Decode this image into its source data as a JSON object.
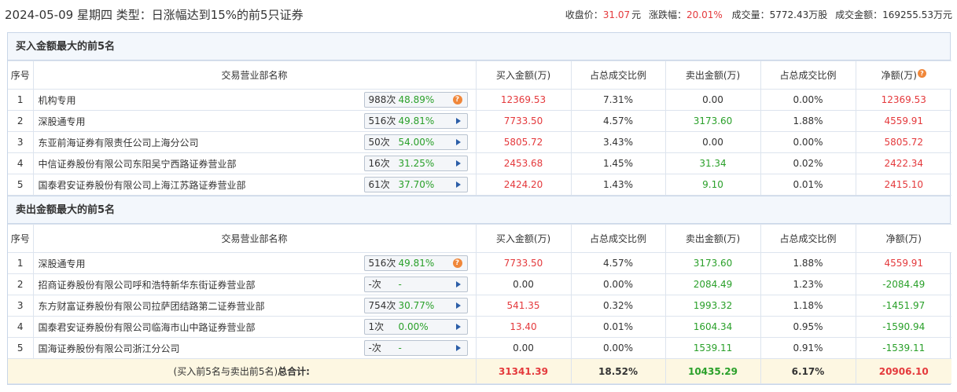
{
  "header": {
    "title": "2024-05-09 星期四 类型：日涨幅达到15%的前5只证券",
    "close_label": "收盘价：",
    "close_value": "31.07",
    "close_unit": "元",
    "change_label": "涨跌幅：",
    "change_value": "20.01%",
    "volume_label": "成交量：",
    "volume_value": "5772.43万股",
    "amount_label": "成交金额：",
    "amount_value": "169255.53万元"
  },
  "columns": [
    "序号",
    "交易营业部名称",
    "买入金额(万)",
    "占总成交比例",
    "卖出金额(万)",
    "占总成交比例",
    "净额(万)"
  ],
  "buy_section": {
    "title": "买入金额最大的前5名",
    "rows": [
      {
        "idx": "1",
        "name": "机构专用",
        "count": "988次",
        "pct": "48.89%",
        "icon": "question-icon",
        "buy": "12369.53",
        "buy_ratio": "7.31%",
        "sell": "0.00",
        "sell_ratio": "0.00%",
        "net": "12369.53",
        "sell_color": "dark",
        "net_color": "red"
      },
      {
        "idx": "2",
        "name": "深股通专用",
        "count": "516次",
        "pct": "49.81%",
        "icon": "arrow-right-icon",
        "buy": "7733.50",
        "buy_ratio": "4.57%",
        "sell": "3173.60",
        "sell_ratio": "1.88%",
        "net": "4559.91",
        "sell_color": "green",
        "net_color": "red"
      },
      {
        "idx": "3",
        "name": "东亚前海证券有限责任公司上海分公司",
        "count": "50次",
        "pct": "54.00%",
        "icon": "arrow-right-icon",
        "buy": "5805.72",
        "buy_ratio": "3.43%",
        "sell": "0.00",
        "sell_ratio": "0.00%",
        "net": "5805.72",
        "sell_color": "dark",
        "net_color": "red"
      },
      {
        "idx": "4",
        "name": "中信证券股份有限公司东阳吴宁西路证券营业部",
        "count": "16次",
        "pct": "31.25%",
        "icon": "arrow-right-icon",
        "buy": "2453.68",
        "buy_ratio": "1.45%",
        "sell": "31.34",
        "sell_ratio": "0.02%",
        "net": "2422.34",
        "sell_color": "green",
        "net_color": "red"
      },
      {
        "idx": "5",
        "name": "国泰君安证券股份有限公司上海江苏路证券营业部",
        "count": "61次",
        "pct": "37.70%",
        "icon": "arrow-right-icon",
        "buy": "2424.20",
        "buy_ratio": "1.43%",
        "sell": "9.10",
        "sell_ratio": "0.01%",
        "net": "2415.10",
        "sell_color": "green",
        "net_color": "red"
      }
    ]
  },
  "sell_section": {
    "title": "卖出金额最大的前5名",
    "rows": [
      {
        "idx": "1",
        "name": "深股通专用",
        "count": "516次",
        "pct": "49.81%",
        "icon": "question-icon",
        "buy": "7733.50",
        "buy_ratio": "4.57%",
        "sell": "3173.60",
        "sell_ratio": "1.88%",
        "net": "4559.91",
        "buy_color": "red",
        "net_color": "red"
      },
      {
        "idx": "2",
        "name": "招商证券股份有限公司呼和浩特新华东街证券营业部",
        "count": "-次",
        "pct": "-",
        "icon": "arrow-right-icon",
        "buy": "0.00",
        "buy_ratio": "0.00%",
        "sell": "2084.49",
        "sell_ratio": "1.23%",
        "net": "-2084.49",
        "buy_color": "dark",
        "net_color": "green"
      },
      {
        "idx": "3",
        "name": "东方财富证券股份有限公司拉萨团结路第二证券营业部",
        "count": "754次",
        "pct": "30.77%",
        "icon": "arrow-right-icon",
        "buy": "541.35",
        "buy_ratio": "0.32%",
        "sell": "1993.32",
        "sell_ratio": "1.18%",
        "net": "-1451.97",
        "buy_color": "red",
        "net_color": "green"
      },
      {
        "idx": "4",
        "name": "国泰君安证券股份有限公司临海市山中路证券营业部",
        "count": "1次",
        "pct": "0.00%",
        "icon": "arrow-right-icon",
        "buy": "13.40",
        "buy_ratio": "0.01%",
        "sell": "1604.34",
        "sell_ratio": "0.95%",
        "net": "-1590.94",
        "buy_color": "red",
        "net_color": "green"
      },
      {
        "idx": "5",
        "name": "国海证券股份有限公司浙江分公司",
        "count": "-次",
        "pct": "-",
        "icon": "arrow-right-icon",
        "buy": "0.00",
        "buy_ratio": "0.00%",
        "sell": "1539.11",
        "sell_ratio": "0.91%",
        "net": "-1539.11",
        "buy_color": "dark",
        "net_color": "green"
      }
    ],
    "total": {
      "label_prefix": "(买入前5名与卖出前5名)",
      "label_bold": "总合计:",
      "buy": "31341.39",
      "buy_ratio": "18.52%",
      "sell": "10435.29",
      "sell_ratio": "6.17%",
      "net": "20906.10"
    }
  },
  "colors": {
    "red": "#e4393c",
    "green": "#2aa02a",
    "header_bg": "#f3f7fc",
    "total_bg": "#fdf7e2",
    "border": "#c9d6e8"
  }
}
